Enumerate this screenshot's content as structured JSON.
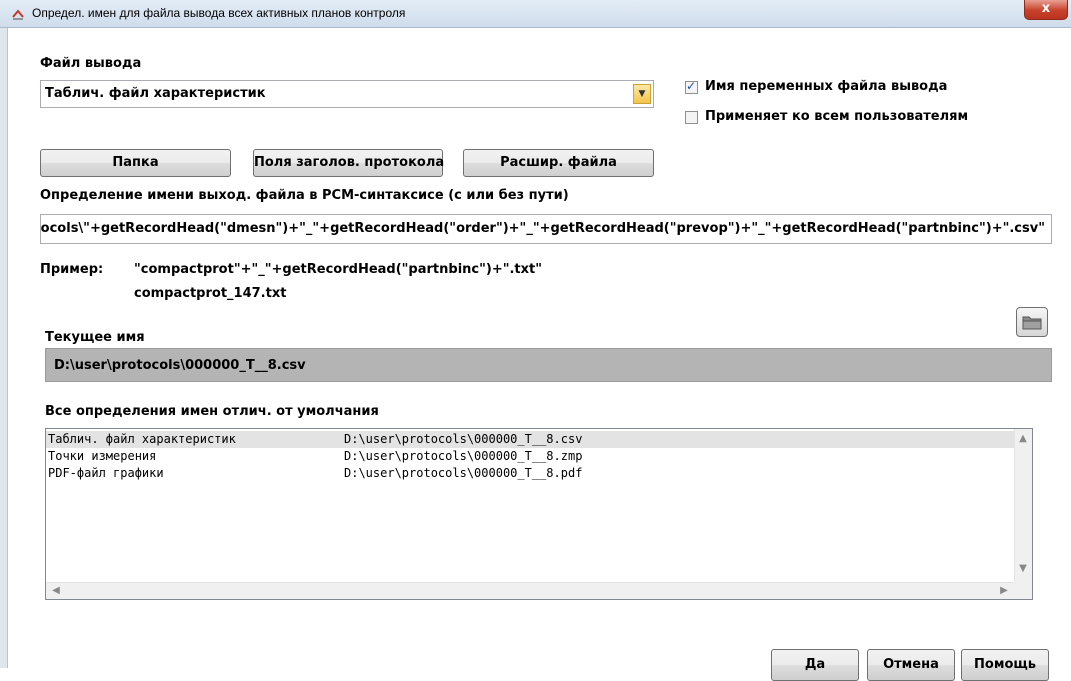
{
  "window": {
    "title": "Определ. имен для файла вывода всех активных планов контроля",
    "close": "x"
  },
  "output_file": {
    "label": "Файл вывода",
    "selected": "Таблич. файл характеристик"
  },
  "options": {
    "variable_names": {
      "label": "Имя переменных файла вывода",
      "checked": true
    },
    "apply_all_users": {
      "label": "Применяет ко всем пользователям",
      "checked": false
    }
  },
  "buttons": {
    "folder": "Папка",
    "header_fields": "Поля заголов. протокола",
    "file_ext": "Расшир. файла"
  },
  "definition": {
    "label": "Определение имени выход. файла в  PCM-синтаксисе (с или без пути)",
    "value": "\\protocols\\\"+getRecordHead(\"dmesn\")+\"_\"+getRecordHead(\"order\")+\"_\"+getRecordHead(\"prevop\")+\"_\"+getRecordHead(\"partnbinc\")+\".csv\""
  },
  "example": {
    "label": "Пример:",
    "expression": "\"compactprot\"+\"_\"+getRecordHead(\"partnbinc\")+\".txt\"",
    "result": "compactprot_147.txt"
  },
  "current": {
    "label": "Текущее имя",
    "value": "D:\\user\\protocols\\000000_T__8.csv"
  },
  "list": {
    "label": "Все определения имен отлич. от умолчания",
    "rows": [
      {
        "name": "Таблич. файл характеристик",
        "path": "D:\\user\\protocols\\000000_T__8.csv"
      },
      {
        "name": "Точки измерения",
        "path": "D:\\user\\protocols\\000000_T__8.zmp"
      },
      {
        "name": "PDF-файл графики",
        "path": "D:\\user\\protocols\\000000_T__8.pdf"
      }
    ]
  },
  "footer": {
    "ok": "Да",
    "cancel": "Отмена",
    "help": "Помощь"
  }
}
